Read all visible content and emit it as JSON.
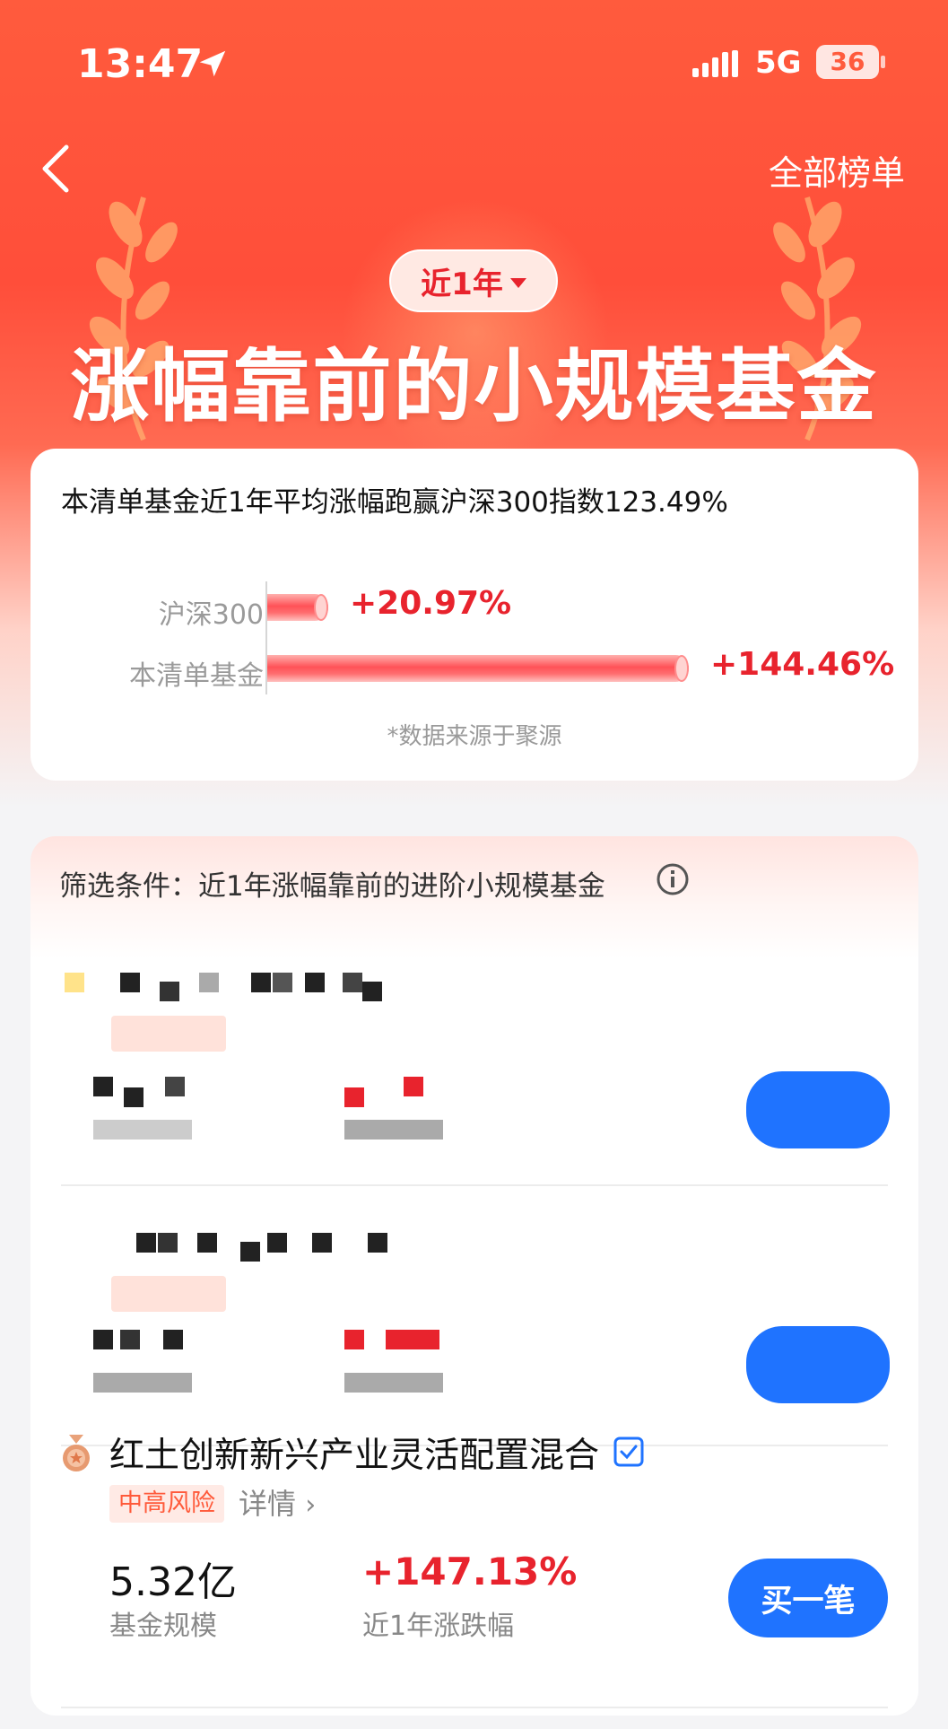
{
  "status_bar": {
    "time": "13:47",
    "network": "5G",
    "battery": "36"
  },
  "header": {
    "all_list_label": "全部榜单",
    "period_selector": "近1年",
    "title": "涨幅靠前的小规模基金"
  },
  "summary": {
    "text": "本清单基金近1年平均涨幅跑赢沪深300指数123.49%",
    "bars": [
      {
        "label": "沪深300",
        "value": "+20.97%",
        "percent": 20.97
      },
      {
        "label": "本清单基金",
        "value": "+144.46%",
        "percent": 144.46
      }
    ],
    "source": "*数据来源于聚源"
  },
  "filter": {
    "text": "筛选条件：近1年涨幅靠前的进阶小规模基金"
  },
  "funds": [
    {
      "name": "红土创新新兴产业灵活配置混合",
      "risk": "中高风险",
      "detail_label": "详情",
      "scale": "5.32亿",
      "scale_label": "基金规模",
      "return": "+147.13%",
      "return_label": "近1年涨跌幅",
      "buy_label": "买一笔"
    }
  ],
  "colors": {
    "accent_red": "#e8232d",
    "header_orange": "#ff5b3d",
    "buy_blue": "#1f73ff"
  }
}
